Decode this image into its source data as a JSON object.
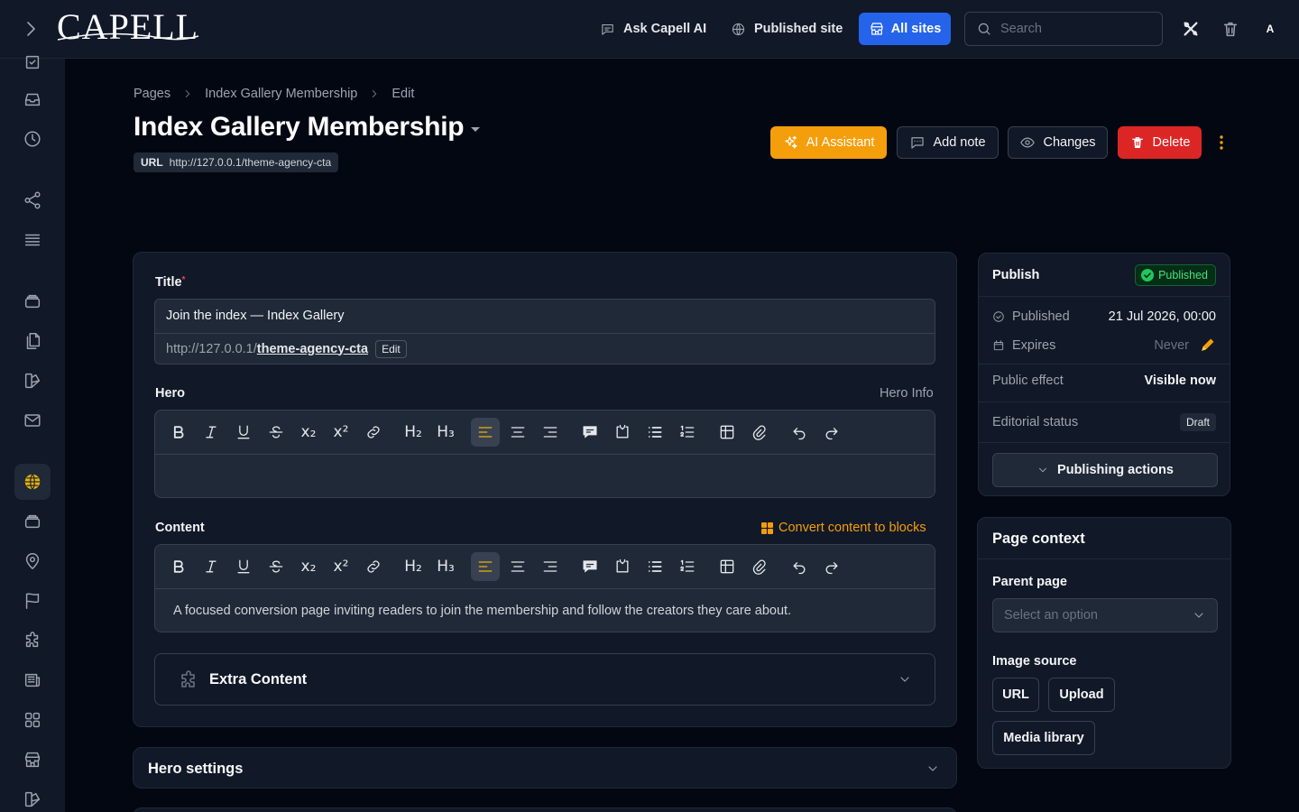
{
  "topbar": {
    "logo": "CAPELL",
    "ask_ai": "Ask Capell AI",
    "published_site": "Published site",
    "all_sites": "All sites",
    "search_placeholder": "Search",
    "avatar": "A"
  },
  "breadcrumb": [
    "Pages",
    "Index Gallery Membership",
    "Edit"
  ],
  "page": {
    "title": "Index Gallery Membership",
    "url_label": "URL",
    "url": "http://127.0.0.1/theme-agency-cta"
  },
  "actions": {
    "ai_assistant": "AI Assistant",
    "add_note": "Add note",
    "changes": "Changes",
    "delete": "Delete"
  },
  "form": {
    "title_label": "Title",
    "title_value": "Join the index — Index Gallery",
    "slug_prefix": "http://127.0.0.1/",
    "slug": "theme-agency-cta",
    "slug_edit": "Edit",
    "hero_label": "Hero",
    "hero_info": "Hero Info",
    "hero_text": "",
    "content_label": "Content",
    "convert_blocks": "Convert content to blocks",
    "content_text": "A focused conversion page inviting readers to join the membership and follow the creators they care about.",
    "extra_content": "Extra Content",
    "hero_settings": "Hero settings"
  },
  "toolbar": {
    "h2": "H₂",
    "h3": "H₃",
    "subscript": "x₂",
    "superscript": "x²"
  },
  "publish": {
    "title": "Publish",
    "status_badge": "Published",
    "published_label": "Published",
    "published_value": "21 Jul 2026, 00:00",
    "expires_label": "Expires",
    "expires_value": "Never",
    "public_effect_label": "Public effect",
    "public_effect_value": "Visible now",
    "editorial_label": "Editorial status",
    "editorial_value": "Draft",
    "actions_label": "Publishing actions"
  },
  "context": {
    "title": "Page context",
    "parent_label": "Parent page",
    "parent_placeholder": "Select an option",
    "image_label": "Image source",
    "btn_url": "URL",
    "btn_upload": "Upload",
    "btn_media": "Media library"
  },
  "colors": {
    "accent": "#f59e0b",
    "primary": "#2563eb",
    "danger": "#dc2626",
    "success": "#22c55e"
  }
}
